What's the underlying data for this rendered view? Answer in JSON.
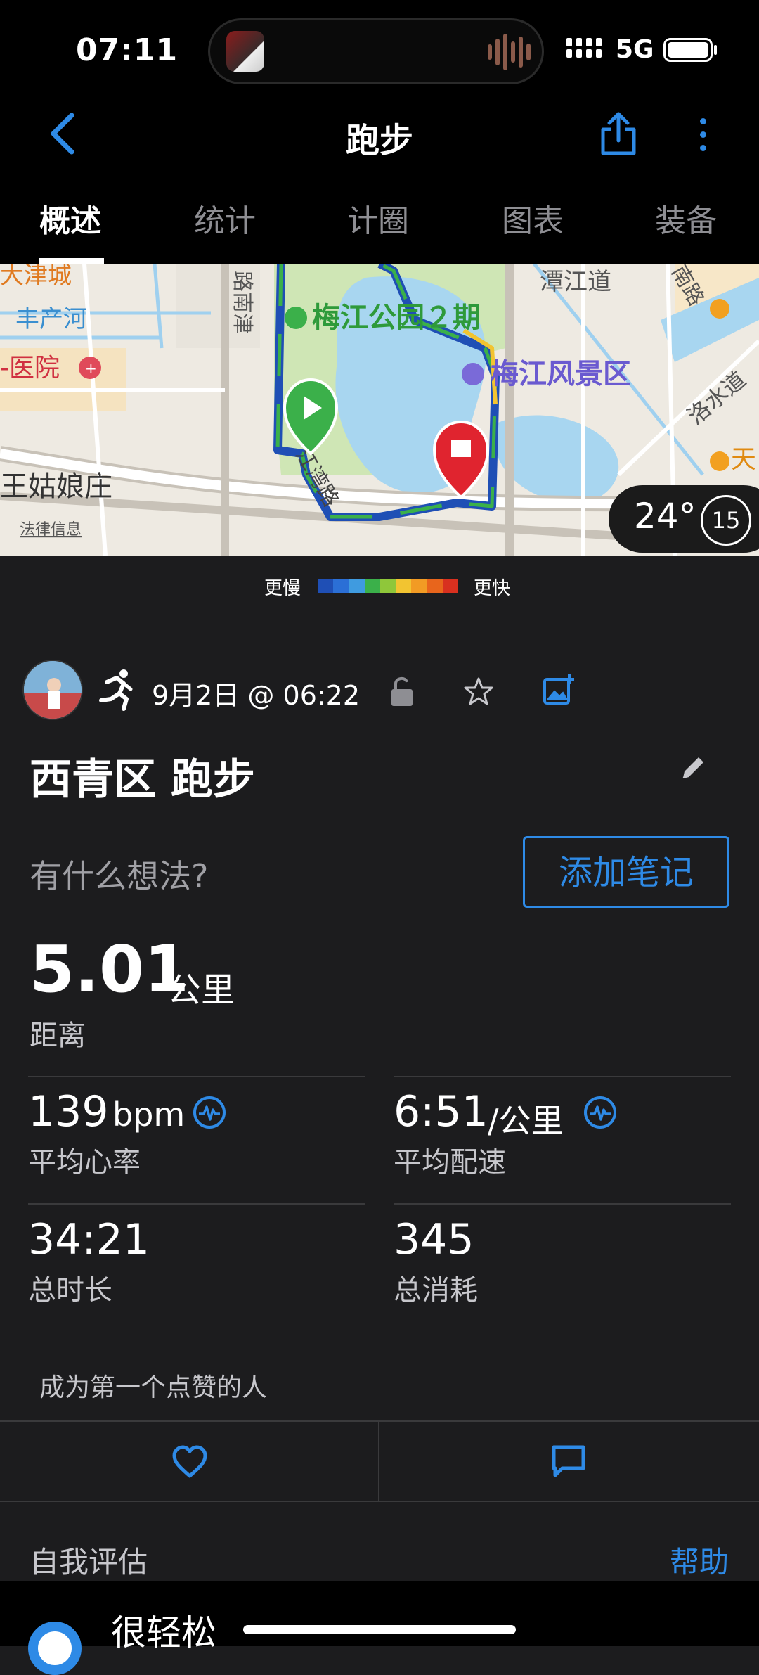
{
  "status_bar": {
    "time": "07:11",
    "network": "5G"
  },
  "header": {
    "title": "跑步"
  },
  "tabs": [
    {
      "label": "概述"
    },
    {
      "label": "统计"
    },
    {
      "label": "计圈"
    },
    {
      "label": "图表"
    },
    {
      "label": "装备"
    }
  ],
  "map": {
    "labels": [
      "大津城",
      "丰产河",
      "医院",
      "津南路",
      "梅江公园２期",
      "潭江道",
      "梅江风景区",
      "洛水道",
      "天",
      "江湾路",
      "姑娘庄",
      "南路"
    ],
    "legal_link": "法律信息",
    "weather": {
      "temp": "24°",
      "wind": "15"
    }
  },
  "pace_legend": {
    "slow": "更慢",
    "fast": "更快",
    "colors": [
      "#1f4fb5",
      "#2b6fd6",
      "#3f9be0",
      "#3bb04a",
      "#8fc73a",
      "#f2c431",
      "#f29b24",
      "#e8651c",
      "#d8301f"
    ]
  },
  "activity": {
    "date": "9月2日 @ 06:22",
    "title": "西青区 跑步",
    "thoughts_placeholder": "有什么想法?",
    "add_note_label": "添加笔记",
    "distance": {
      "value": "5.01",
      "unit": "公里",
      "label": "距离"
    },
    "avg_hr": {
      "value": "139",
      "unit": "bpm",
      "label": "平均心率"
    },
    "avg_pace": {
      "value": "6:51",
      "unit": "/公里",
      "label": "平均配速"
    },
    "duration": {
      "value": "34:21",
      "label": "总时长"
    },
    "calories": {
      "value": "345",
      "label": "总消耗"
    },
    "likes_text": "成为第一个点赞的人"
  },
  "self_eval": {
    "title": "自我评估",
    "help": "帮助",
    "first_option": "很轻松"
  },
  "colors": {
    "accent": "#2e8ae6",
    "background": "#1c1c1e",
    "header_bg": "#000000"
  }
}
